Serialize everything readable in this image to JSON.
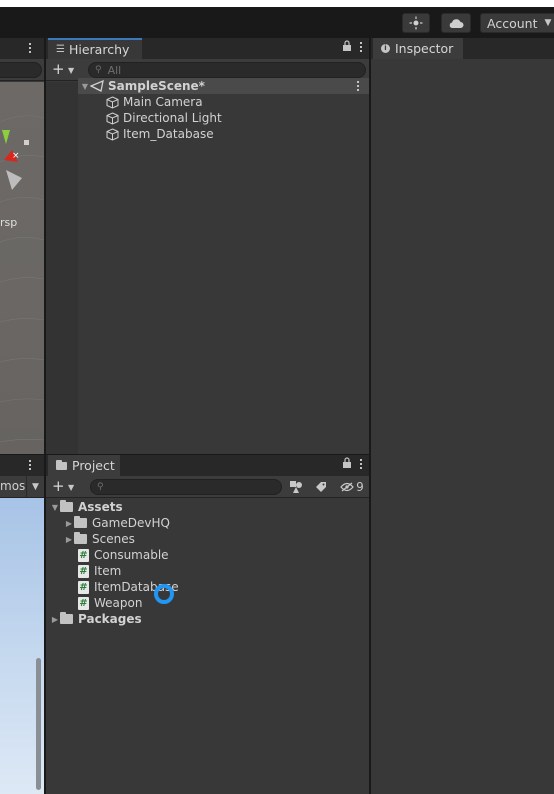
{
  "toolbar": {
    "account_label": "Account"
  },
  "scene_view": {
    "persp_label": "rsp"
  },
  "game_view": {
    "gizmos_label": "mos"
  },
  "hierarchy": {
    "tab_label": "Hierarchy",
    "search_placeholder": "All",
    "scene_name": "SampleScene*",
    "items": [
      {
        "label": "Main Camera"
      },
      {
        "label": "Directional Light"
      },
      {
        "label": "Item_Database"
      }
    ]
  },
  "inspector": {
    "tab_label": "Inspector"
  },
  "project": {
    "tab_label": "Project",
    "hidden_count": "9",
    "assets_label": "Assets",
    "folders": [
      {
        "label": "GameDevHQ"
      },
      {
        "label": "Scenes"
      }
    ],
    "scripts": [
      {
        "label": "Consumable"
      },
      {
        "label": "Item"
      },
      {
        "label": "ItemDatabase"
      },
      {
        "label": "Weapon"
      }
    ],
    "packages_label": "Packages"
  },
  "colors": {
    "accent": "#3a79bb",
    "panel": "#383838",
    "cursor": "#2196f3"
  }
}
